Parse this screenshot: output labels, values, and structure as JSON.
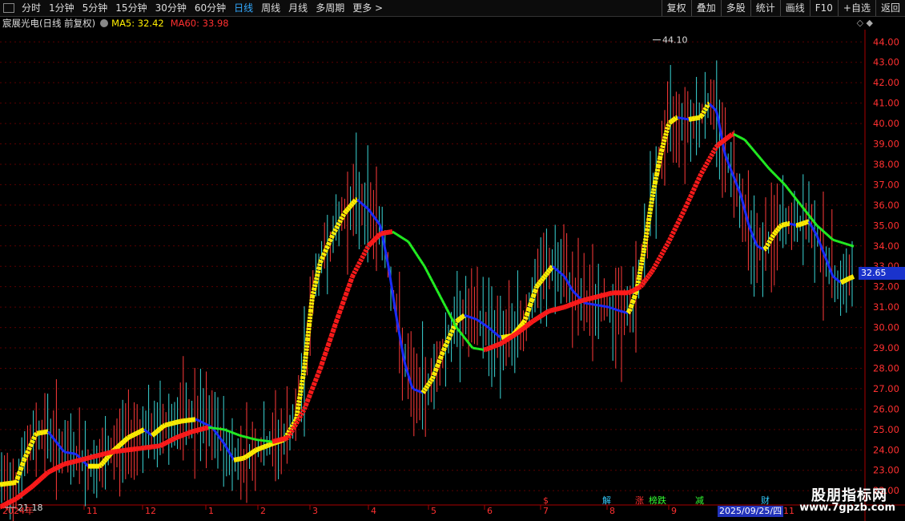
{
  "toolbar": {
    "periods": [
      "分时",
      "1分钟",
      "5分钟",
      "15分钟",
      "30分钟",
      "60分钟",
      "日线",
      "周线",
      "月线",
      "多周期",
      "更多 >"
    ],
    "active_period": "日线",
    "right_buttons": [
      "复权",
      "叠加",
      "多股",
      "统计",
      "画线",
      "F10",
      "+自选",
      "返回"
    ]
  },
  "info": {
    "stock_name": "宸展光电(日线 前复权)",
    "ma5_label": "MA5: 32.42",
    "ma60_label": "MA60: 33.98",
    "top_icons": "◇ ◆"
  },
  "price_badge": "32.65",
  "date_badge": "2025/09/25/四",
  "event_markers": [
    {
      "text": "$",
      "month_index": 7,
      "color": "#ff3030"
    },
    {
      "text": "解",
      "month_index": 8,
      "color": "#33ccff"
    },
    {
      "text": "涨",
      "month_index": 9,
      "color": "#ff3030"
    },
    {
      "text": "榜跌",
      "month_index": 9.4,
      "color": "#33ff33"
    },
    {
      "text": "减",
      "month_index": 10,
      "color": "#33ff33"
    },
    {
      "text": "财",
      "month_index": 11,
      "color": "#33ccff"
    }
  ],
  "watermark": {
    "line1": "股朋指标网",
    "line2": "www.7gpzb.com"
  },
  "chart_data": {
    "type": "candlestick_with_ma",
    "y_axis_ticks": [
      22.0,
      23.0,
      24.0,
      25.0,
      26.0,
      27.0,
      28.0,
      29.0,
      30.0,
      31.0,
      32.0,
      33.0,
      34.0,
      35.0,
      36.0,
      37.0,
      38.0,
      39.0,
      40.0,
      41.0,
      42.0,
      43.0,
      44.0
    ],
    "ylim": [
      21.3,
      44.6
    ],
    "x_axis_labels": [
      "2024年",
      "11",
      "12",
      "1",
      "2",
      "3",
      "4",
      "5",
      "6",
      "7",
      "8",
      "9",
      "2025/09/25/四",
      "11"
    ],
    "high_annotation": "44.10",
    "low_annotation": "21.18",
    "current_price": 32.65,
    "series": [
      {
        "name": "MA5",
        "color_up": "#ffee00",
        "color_down": "#1a2cff",
        "points": [
          [
            0,
            22.3
          ],
          [
            20,
            22.4
          ],
          [
            30,
            23.5
          ],
          [
            45,
            24.8
          ],
          [
            60,
            24.9
          ],
          [
            80,
            23.9
          ],
          [
            95,
            23.8
          ],
          [
            110,
            23.2
          ],
          [
            125,
            23.2
          ],
          [
            140,
            23.9
          ],
          [
            160,
            24.6
          ],
          [
            180,
            25.0
          ],
          [
            190,
            24.7
          ],
          [
            205,
            25.2
          ],
          [
            225,
            25.4
          ],
          [
            245,
            25.5
          ],
          [
            265,
            25.1
          ],
          [
            280,
            24.3
          ],
          [
            292,
            23.5
          ],
          [
            305,
            23.6
          ],
          [
            320,
            24.0
          ],
          [
            340,
            24.3
          ],
          [
            355,
            24.5
          ],
          [
            370,
            25.5
          ],
          [
            380,
            28.0
          ],
          [
            390,
            31.5
          ],
          [
            400,
            33.2
          ],
          [
            415,
            34.5
          ],
          [
            430,
            35.6
          ],
          [
            445,
            36.3
          ],
          [
            460,
            35.8
          ],
          [
            475,
            35.0
          ],
          [
            485,
            33.0
          ],
          [
            495,
            30.5
          ],
          [
            505,
            28.3
          ],
          [
            515,
            27.0
          ],
          [
            528,
            26.8
          ],
          [
            540,
            27.5
          ],
          [
            555,
            29.0
          ],
          [
            570,
            30.3
          ],
          [
            580,
            30.6
          ],
          [
            595,
            30.4
          ],
          [
            610,
            30.0
          ],
          [
            625,
            29.5
          ],
          [
            640,
            29.6
          ],
          [
            655,
            30.3
          ],
          [
            670,
            32.0
          ],
          [
            690,
            33.0
          ],
          [
            705,
            32.5
          ],
          [
            715,
            31.8
          ],
          [
            730,
            31.2
          ],
          [
            745,
            31.1
          ],
          [
            760,
            31.0
          ],
          [
            775,
            30.8
          ],
          [
            785,
            30.7
          ],
          [
            795,
            31.8
          ],
          [
            805,
            34.0
          ],
          [
            815,
            36.5
          ],
          [
            825,
            38.5
          ],
          [
            835,
            40.0
          ],
          [
            845,
            40.3
          ],
          [
            860,
            40.2
          ],
          [
            875,
            40.3
          ],
          [
            885,
            41.0
          ],
          [
            895,
            40.6
          ],
          [
            905,
            38.5
          ],
          [
            915,
            37.5
          ],
          [
            925,
            36.5
          ],
          [
            935,
            35.0
          ],
          [
            945,
            34.0
          ],
          [
            955,
            33.8
          ],
          [
            965,
            34.5
          ],
          [
            975,
            35.0
          ],
          [
            985,
            35.1
          ],
          [
            995,
            35.0
          ],
          [
            1010,
            35.2
          ],
          [
            1020,
            34.5
          ],
          [
            1030,
            33.5
          ],
          [
            1040,
            32.5
          ],
          [
            1050,
            32.2
          ],
          [
            1060,
            32.4
          ],
          [
            1066,
            32.5
          ]
        ]
      },
      {
        "name": "MA60",
        "color_up": "#ff1a1a",
        "color_down": "#22ee22",
        "points": [
          [
            0,
            21.2
          ],
          [
            20,
            21.6
          ],
          [
            40,
            22.2
          ],
          [
            60,
            22.9
          ],
          [
            80,
            23.3
          ],
          [
            100,
            23.5
          ],
          [
            120,
            23.7
          ],
          [
            140,
            23.9
          ],
          [
            160,
            24.0
          ],
          [
            180,
            24.1
          ],
          [
            200,
            24.2
          ],
          [
            220,
            24.6
          ],
          [
            240,
            24.9
          ],
          [
            260,
            25.1
          ],
          [
            280,
            25.0
          ],
          [
            300,
            24.7
          ],
          [
            320,
            24.5
          ],
          [
            340,
            24.4
          ],
          [
            360,
            24.6
          ],
          [
            380,
            26.0
          ],
          [
            400,
            28.0
          ],
          [
            420,
            30.3
          ],
          [
            440,
            32.5
          ],
          [
            460,
            34.0
          ],
          [
            475,
            34.6
          ],
          [
            490,
            34.7
          ],
          [
            510,
            34.2
          ],
          [
            530,
            33.0
          ],
          [
            550,
            31.5
          ],
          [
            570,
            30.0
          ],
          [
            590,
            29.0
          ],
          [
            605,
            28.9
          ],
          [
            625,
            29.2
          ],
          [
            645,
            29.7
          ],
          [
            665,
            30.3
          ],
          [
            685,
            30.8
          ],
          [
            705,
            31.0
          ],
          [
            725,
            31.3
          ],
          [
            745,
            31.5
          ],
          [
            765,
            31.7
          ],
          [
            785,
            31.7
          ],
          [
            800,
            32.0
          ],
          [
            815,
            32.8
          ],
          [
            835,
            34.2
          ],
          [
            855,
            35.8
          ],
          [
            875,
            37.5
          ],
          [
            895,
            38.9
          ],
          [
            915,
            39.5
          ],
          [
            930,
            39.2
          ],
          [
            945,
            38.5
          ],
          [
            960,
            37.8
          ],
          [
            980,
            37.0
          ],
          [
            1000,
            36.0
          ],
          [
            1020,
            35.0
          ],
          [
            1040,
            34.3
          ],
          [
            1066,
            33.98
          ]
        ]
      }
    ]
  }
}
